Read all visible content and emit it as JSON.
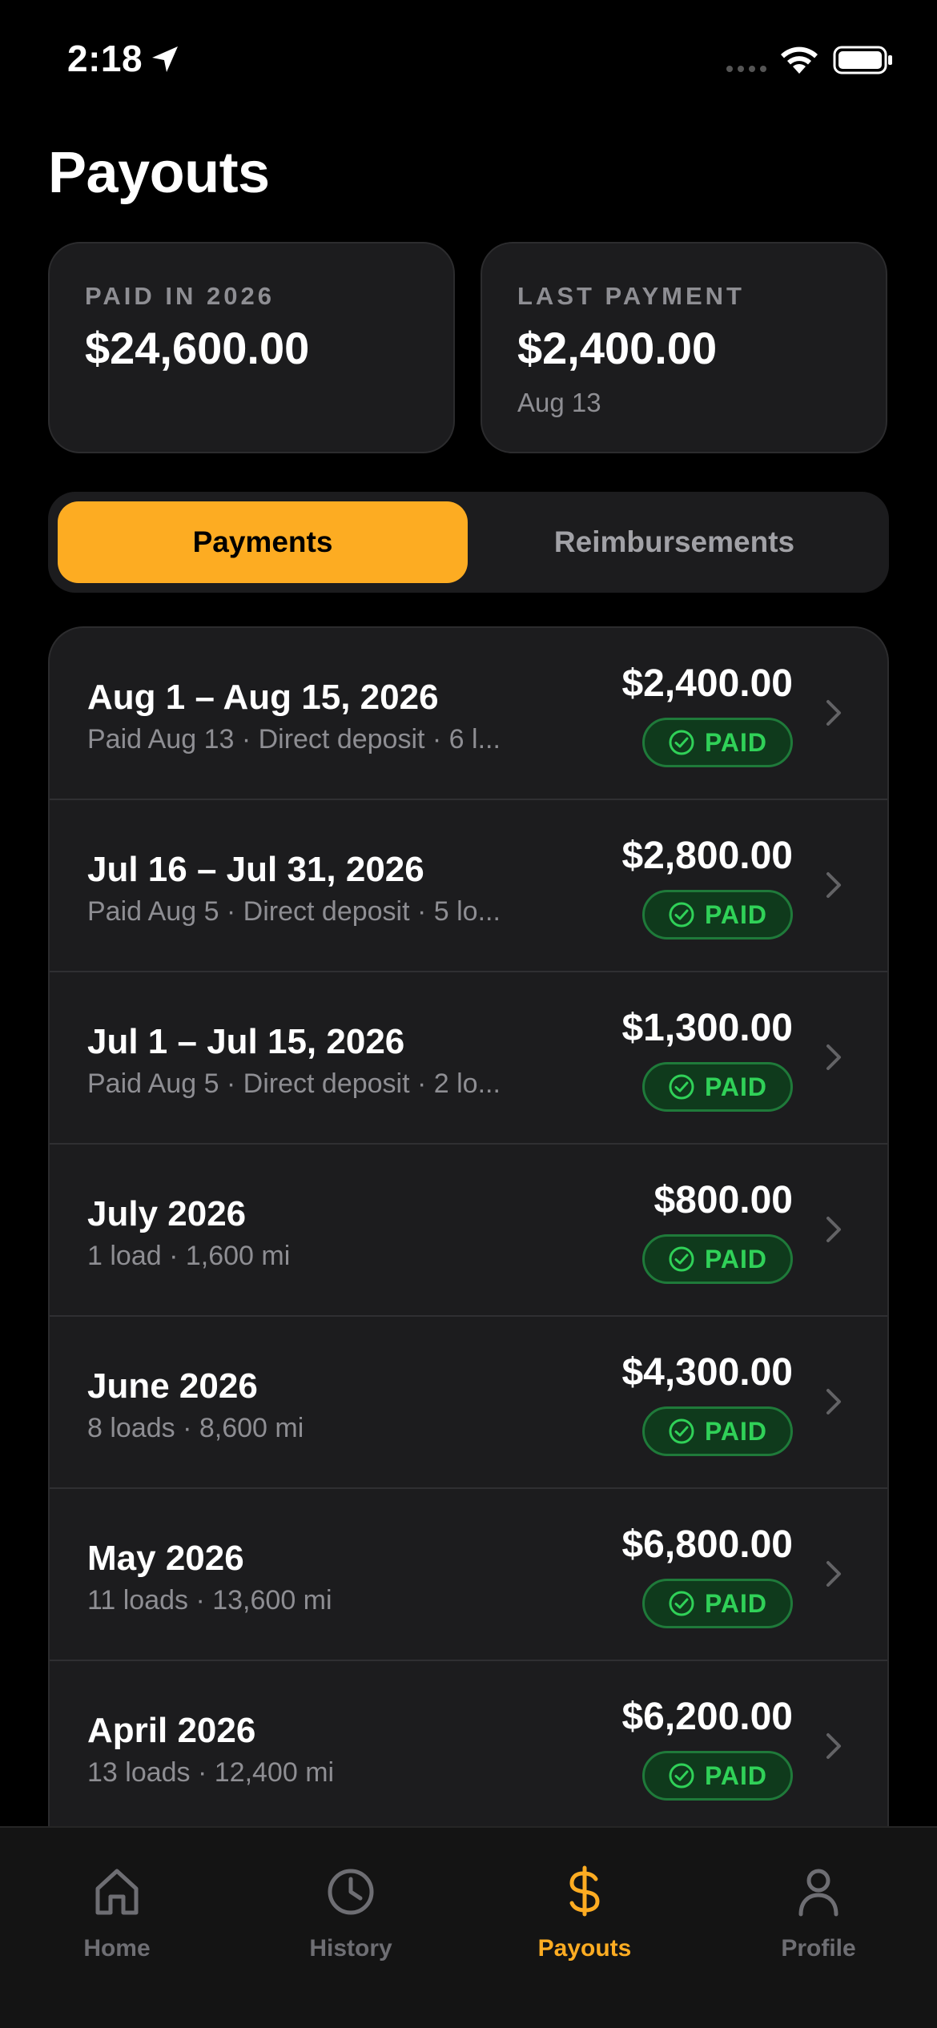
{
  "status_bar": {
    "time": "2:18"
  },
  "page": {
    "title": "Payouts"
  },
  "summary": {
    "paid_label": "PAID IN 2026",
    "paid_value": "$24,600.00",
    "last_label": "LAST PAYMENT",
    "last_value": "$2,400.00",
    "last_date": "Aug 13"
  },
  "segments": {
    "active": "Payments",
    "inactive": "Reimbursements"
  },
  "rows": [
    {
      "title": "Aug 1 – Aug 15, 2026",
      "subtitle": "Paid Aug 13  ·  Direct deposit  ·  6 l...",
      "amount": "$2,400.00",
      "status": "PAID"
    },
    {
      "title": "Jul 16 – Jul 31, 2026",
      "subtitle": "Paid Aug 5  ·  Direct deposit  ·  5 lo...",
      "amount": "$2,800.00",
      "status": "PAID"
    },
    {
      "title": "Jul 1 – Jul 15, 2026",
      "subtitle": "Paid Aug 5  ·  Direct deposit  ·  2 lo...",
      "amount": "$1,300.00",
      "status": "PAID"
    },
    {
      "title": "July 2026",
      "subtitle": "1 load · 1,600 mi",
      "amount": "$800.00",
      "status": "PAID"
    },
    {
      "title": "June 2026",
      "subtitle": "8 loads · 8,600 mi",
      "amount": "$4,300.00",
      "status": "PAID"
    },
    {
      "title": "May 2026",
      "subtitle": "11 loads · 13,600 mi",
      "amount": "$6,800.00",
      "status": "PAID"
    },
    {
      "title": "April 2026",
      "subtitle": "13 loads · 12,400 mi",
      "amount": "$6,200.00",
      "status": "PAID"
    }
  ],
  "tabs": [
    {
      "label": "Home",
      "icon": "home-icon"
    },
    {
      "label": "History",
      "icon": "clock-icon"
    },
    {
      "label": "Payouts",
      "icon": "dollar-icon",
      "active": true
    },
    {
      "label": "Profile",
      "icon": "person-icon"
    }
  ],
  "colors": {
    "accent": "#fdac22",
    "paid_green": "#30d158",
    "card_bg": "#1c1c1e"
  }
}
